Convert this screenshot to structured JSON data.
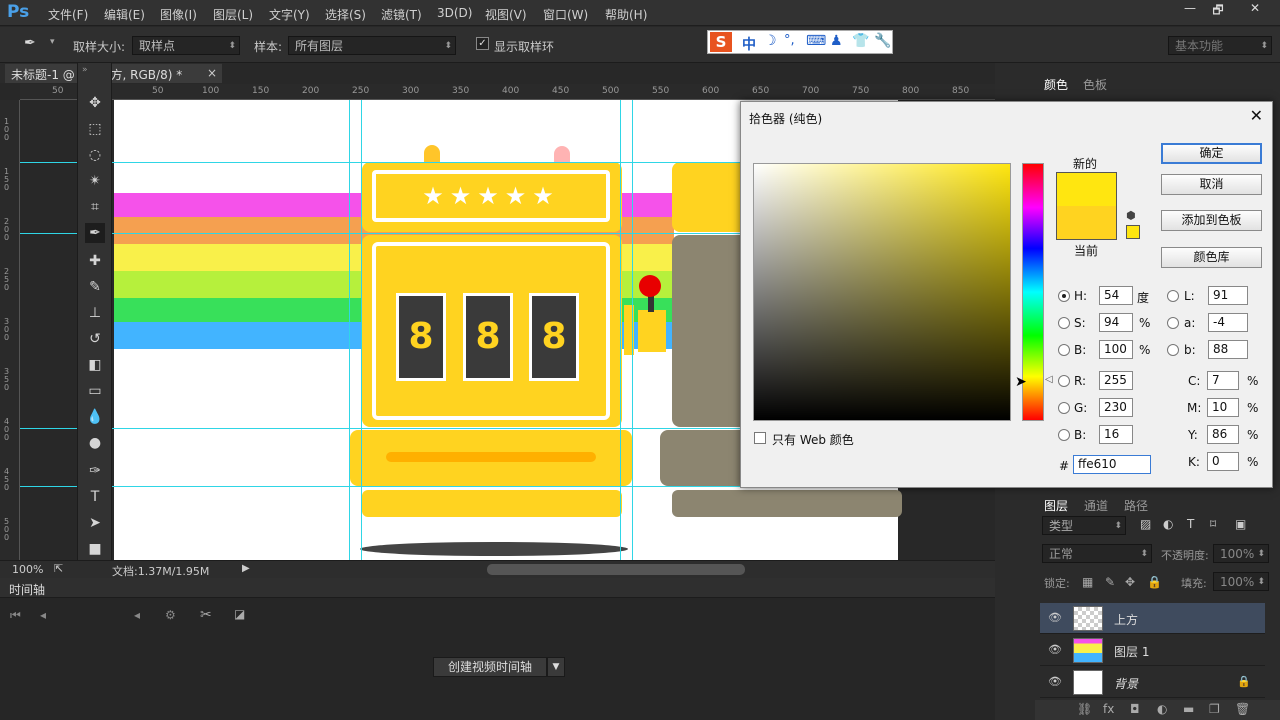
{
  "app": {
    "logo": "Ps"
  },
  "menu": [
    "文件(F)",
    "编辑(E)",
    "图像(I)",
    "图层(L)",
    "文字(Y)",
    "选择(S)",
    "滤镜(T)",
    "3D(D)",
    "视图(V)",
    "窗口(W)",
    "帮助(H)"
  ],
  "window_controls": {
    "minimize": "—",
    "restore": "🗗",
    "close": "✕"
  },
  "options": {
    "sample_size_label": "取样大小:",
    "sample_size_value": "取样点",
    "sample_label": "样本:",
    "sample_value": "所有图层",
    "show_ring_label": "显示取样环",
    "workspace": "基本功能"
  },
  "ime": {
    "logo": "S",
    "lang": "中"
  },
  "document": {
    "tab_title": "未标题-1 @ ... (上方, RGB/8) *",
    "tab_close": "×",
    "zoom": "100%",
    "doc_info": "文档:1.37M/1.95M"
  },
  "ruler_top": [
    "50",
    "0",
    "50",
    "100",
    "150",
    "200",
    "250",
    "300",
    "350",
    "400",
    "450",
    "500",
    "550",
    "600",
    "650",
    "700",
    "750",
    "800",
    "850"
  ],
  "ruler_left": [
    "1 0 0",
    "1 5 0",
    "2 0 0",
    "2 5 0",
    "3 0 0",
    "3 5 0",
    "4 0 0",
    "4 5 0",
    "5 0 0"
  ],
  "slot": {
    "digits": [
      "8",
      "8",
      "8"
    ]
  },
  "timeline": {
    "title": "时间轴",
    "create_button": "创建视频时间轴"
  },
  "color_picker": {
    "title": "拾色器 (纯色)",
    "new_label": "新的",
    "current_label": "当前",
    "new_color": "#ffe610",
    "current_color": "#ffd320",
    "buttons": {
      "ok": "确定",
      "cancel": "取消",
      "add_swatch": "添加到色板",
      "libraries": "颜色库"
    },
    "only_web": "只有 Web 颜色",
    "hsb": {
      "h": "54",
      "s": "94",
      "b": "100",
      "h_unit": "度",
      "s_unit": "%",
      "b_unit": "%"
    },
    "rgb": {
      "r": "255",
      "g": "230",
      "b": "16"
    },
    "lab": {
      "l": "91",
      "a": "-4",
      "b": "88"
    },
    "cmyk": {
      "c": "7",
      "m": "10",
      "y": "86",
      "k": "0",
      "unit": "%"
    },
    "hex": "ffe610",
    "labels": {
      "h": "H:",
      "s": "S:",
      "b": "B:",
      "r": "R:",
      "g": "G:",
      "b2": "B:",
      "l": "L:",
      "a": "a:",
      "lb": "b:",
      "c": "C:",
      "m": "M:",
      "y": "Y:",
      "k": "K:",
      "hash": "#"
    }
  },
  "color_panel": {
    "tabs": [
      "颜色",
      "色板"
    ]
  },
  "layers_panel": {
    "tabs": [
      "图层",
      "通道",
      "路径"
    ],
    "filter_kind": "类型",
    "blend_mode": "正常",
    "opacity_label": "不透明度:",
    "opacity_value": "100%",
    "lock_label": "锁定:",
    "fill_label": "填充:",
    "fill_value": "100%",
    "layers": [
      {
        "name": "上方"
      },
      {
        "name": "图层 1"
      },
      {
        "name": "背景"
      }
    ]
  }
}
